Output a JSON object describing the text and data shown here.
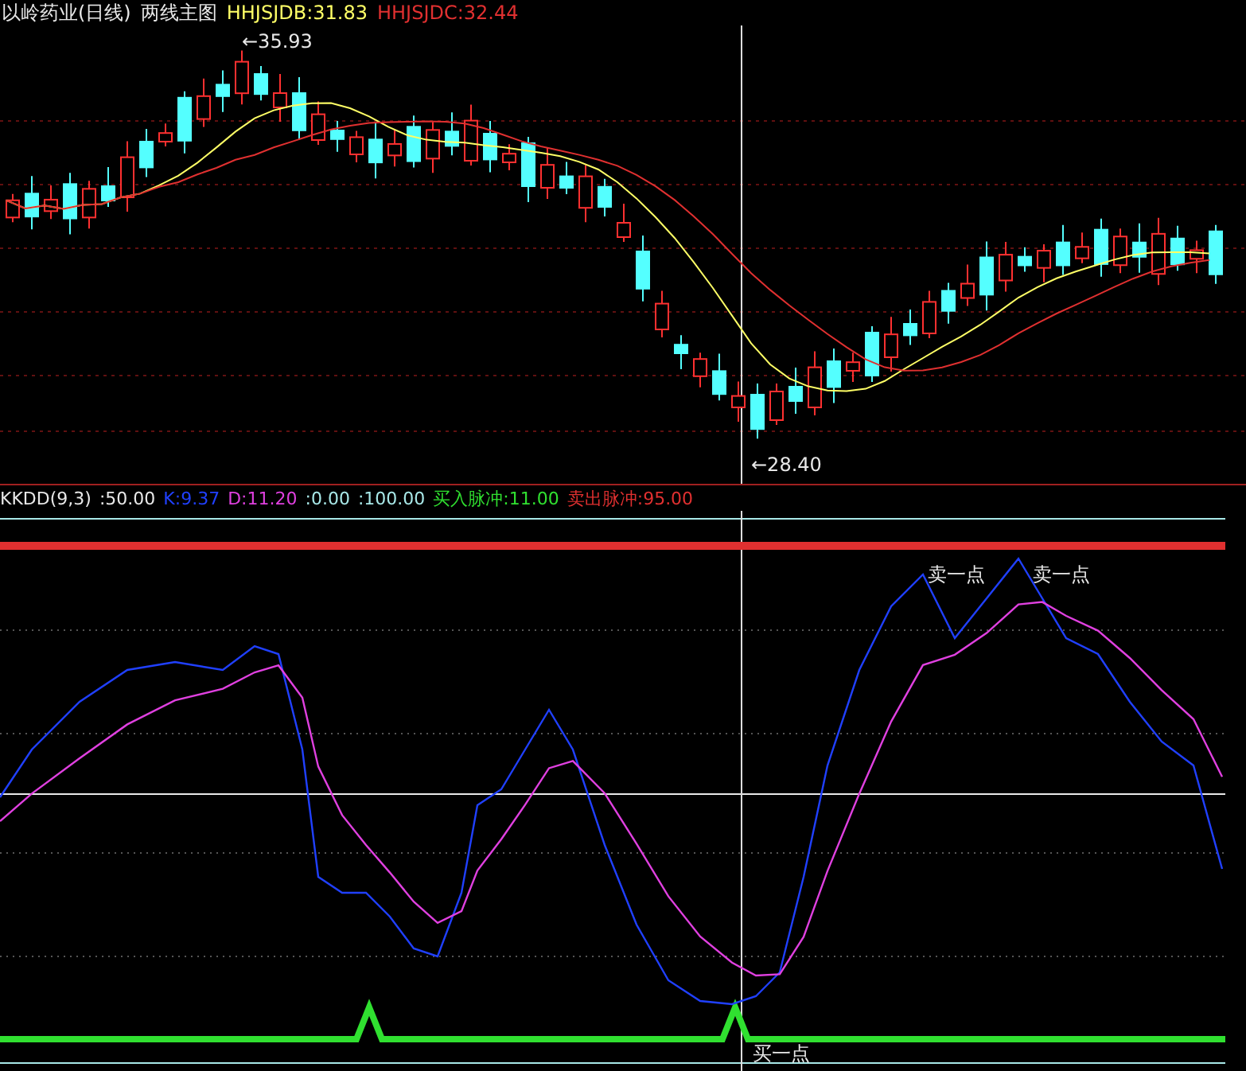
{
  "main_chart": {
    "title": "以岭药业(日线)",
    "subtitle": "两线主图",
    "legend": [
      {
        "text": "HHJSJDB:31.83",
        "color": "#ffff66"
      },
      {
        "text": "HHJSJDC:32.44",
        "color": "#e03030"
      }
    ],
    "high_label": "←35.93",
    "low_label": "←28.40"
  },
  "indicator": {
    "name": "KKDD(9,3)",
    "legend": [
      {
        "text": ":50.00",
        "color": "#e8e8e8"
      },
      {
        "text": "K:9.37",
        "color": "#2040ff"
      },
      {
        "text": "D:11.20",
        "color": "#e040e0"
      },
      {
        "text": ":0.00",
        "color": "#a8e8e8"
      },
      {
        "text": ":100.00",
        "color": "#a8e8e8"
      },
      {
        "text": "买入脉冲:11.00",
        "color": "#30e030"
      },
      {
        "text": "卖出脉冲:95.00",
        "color": "#e03030"
      }
    ],
    "sell_labels": [
      "卖一点",
      "卖一点"
    ],
    "buy_label": "买一点"
  }
}
